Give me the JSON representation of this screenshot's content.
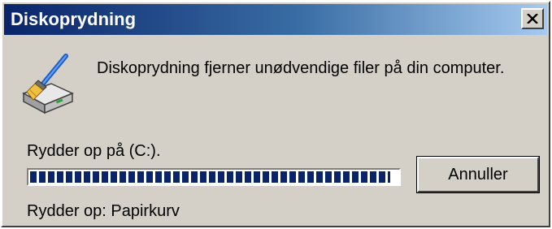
{
  "window": {
    "title": "Diskoprydning",
    "close_icon": "close-icon"
  },
  "main": {
    "icon": "disk-cleanup-icon",
    "description": "Diskoprydning fjerner unødvendige filer på din computer.",
    "status": "Rydder op på  (C:).",
    "progress_fraction": 0.98,
    "cancel_label": "Annuller",
    "detail": "Rydder op: Papirkurv"
  },
  "colors": {
    "titlebar_start": "#0a246a",
    "titlebar_end": "#a6caf0",
    "progress_block": "#0a246a",
    "face": "#d4d0c8"
  }
}
